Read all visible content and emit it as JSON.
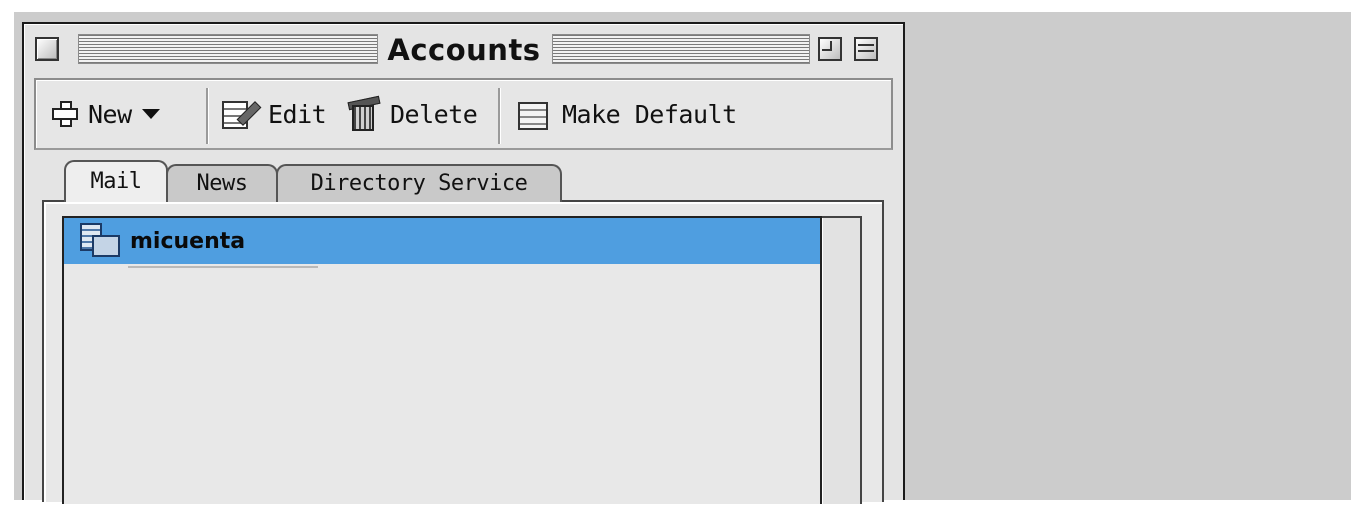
{
  "window": {
    "title": "Accounts"
  },
  "toolbar": {
    "new_label": "New",
    "edit_label": "Edit",
    "delete_label": "Delete",
    "make_default_label": "Make Default"
  },
  "tabs": [
    {
      "label": "Mail",
      "selected": true
    },
    {
      "label": "News",
      "selected": false
    },
    {
      "label": "Directory Service",
      "selected": false
    }
  ],
  "accounts": [
    {
      "name": "micuenta",
      "selected": true
    }
  ],
  "colors": {
    "selection": "#4f9ee0",
    "window_bg": "#e4e4e4",
    "desktop_bg": "#cccccc"
  },
  "icons": {
    "new": "plus-icon",
    "edit": "edit-icon",
    "delete": "trash-icon",
    "make_default": "make-default-icon",
    "account": "mail-account-icon"
  }
}
